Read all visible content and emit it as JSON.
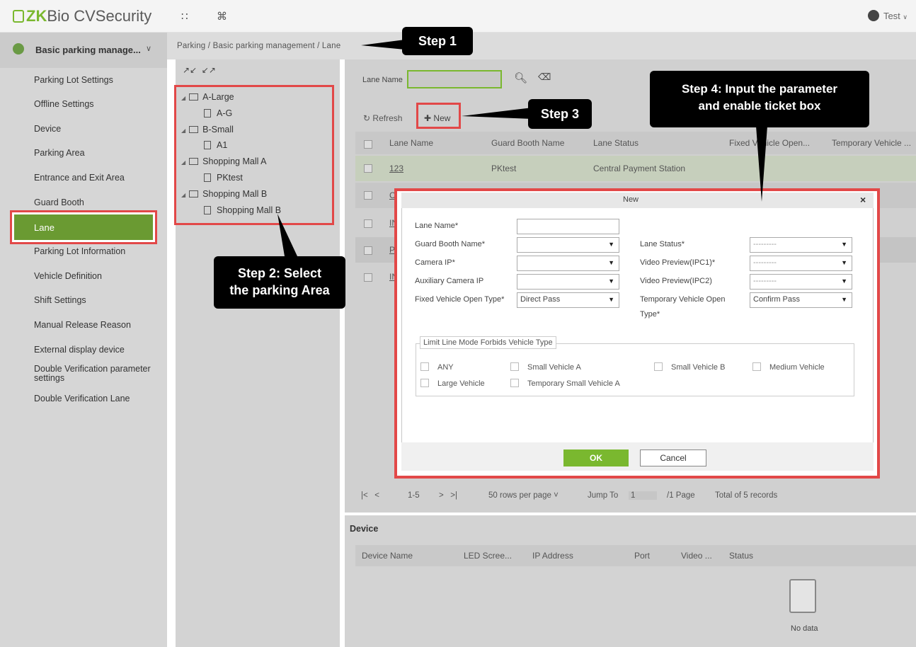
{
  "header": {
    "logo_text": "ZKBio CVSecurity",
    "logo_zk": "ZK",
    "logo_rest": "Bio CVSecurity",
    "apps_icon": "grid-icon",
    "cmd_icon": "command-icon",
    "user": "Test"
  },
  "sidebar": {
    "module": "Basic parking manage...",
    "items": [
      "Parking Lot Settings",
      "Offline Settings",
      "Device",
      "Parking Area",
      "Entrance and Exit Area",
      "Guard Booth",
      "Lane",
      "Parking Lot Information",
      "Vehicle Definition",
      "Shift Settings",
      "Manual Release Reason",
      "External display device",
      "Double Verification parameter settings",
      "Double Verification Lane"
    ],
    "active": "Lane"
  },
  "breadcrumb": "Parking / Basic parking management / Lane",
  "tree": {
    "nodes": [
      {
        "label": "A-Large",
        "children": [
          "A-G"
        ]
      },
      {
        "label": "B-Small",
        "children": [
          "A1"
        ]
      },
      {
        "label": "Shopping Mall A",
        "children": [
          "PKtest"
        ]
      },
      {
        "label": "Shopping Mall B",
        "children": [
          "Shopping Mall B"
        ]
      }
    ]
  },
  "search": {
    "label": "Lane Name",
    "value": ""
  },
  "toolbar": {
    "refresh": "Refresh",
    "new": "New"
  },
  "table": {
    "columns": [
      "Lane Name",
      "Guard Booth Name",
      "Lane Status",
      "Fixed Vehicle Open...",
      "Temporary Vehicle ..."
    ],
    "rows": [
      {
        "lane": "123",
        "booth": "PKtest",
        "status": "Central Payment Station"
      },
      {
        "lane": "C",
        "booth": "",
        "status": ""
      },
      {
        "lane": "IN",
        "booth": "",
        "status": ""
      },
      {
        "lane": "P",
        "booth": "",
        "status": ""
      },
      {
        "lane": "IN",
        "booth": "",
        "status": ""
      }
    ]
  },
  "pager": {
    "range": "1-5",
    "rows_per_page": "50 rows per page",
    "jump_label": "Jump To",
    "page_value": "1",
    "pages": "/1 Page",
    "total": "Total of 5 records"
  },
  "device": {
    "title": "Device",
    "columns": [
      "Device Name",
      "LED Scree...",
      "IP Address",
      "Port",
      "Video ...",
      "Status"
    ],
    "empty": "No data"
  },
  "modal": {
    "title": "New",
    "fields": {
      "lane_name": "Lane Name*",
      "guard_booth": "Guard Booth Name*",
      "camera_ip": "Camera IP*",
      "aux_camera_ip": "Auxiliary Camera IP",
      "fixed_open": "Fixed Vehicle Open Type*",
      "fixed_open_value": "Direct Pass",
      "lane_status": "Lane Status*",
      "lane_status_value": "---------",
      "video_ipc1": "Video Preview(IPC1)*",
      "video_ipc1_value": "---------",
      "video_ipc2": "Video Preview(IPC2)",
      "video_ipc2_value": "---------",
      "temp_open_1": "Temporary Vehicle Open",
      "temp_open_2": "Type*",
      "temp_open_value": "Confirm Pass"
    },
    "limit_legend": "Limit Line Mode Forbids Vehicle Type",
    "vehicle_types": [
      "ANY",
      "Small Vehicle A",
      "Small Vehicle B",
      "Medium Vehicle",
      "Large Vehicle",
      "Temporary Small Vehicle A"
    ],
    "ok": "OK",
    "cancel": "Cancel"
  },
  "callouts": {
    "step1": "Step 1",
    "step2_l1": "Step 2: Select",
    "step2_l2": "the parking Area",
    "step3": "Step 3",
    "step4_l1": "Step 4: Input the parameter",
    "step4_l2": "and enable ticket box"
  },
  "colors": {
    "accent": "#7ab82f",
    "highlight": "#e24848",
    "active_menu": "#6a9a32",
    "callout_bg": "#000000"
  }
}
